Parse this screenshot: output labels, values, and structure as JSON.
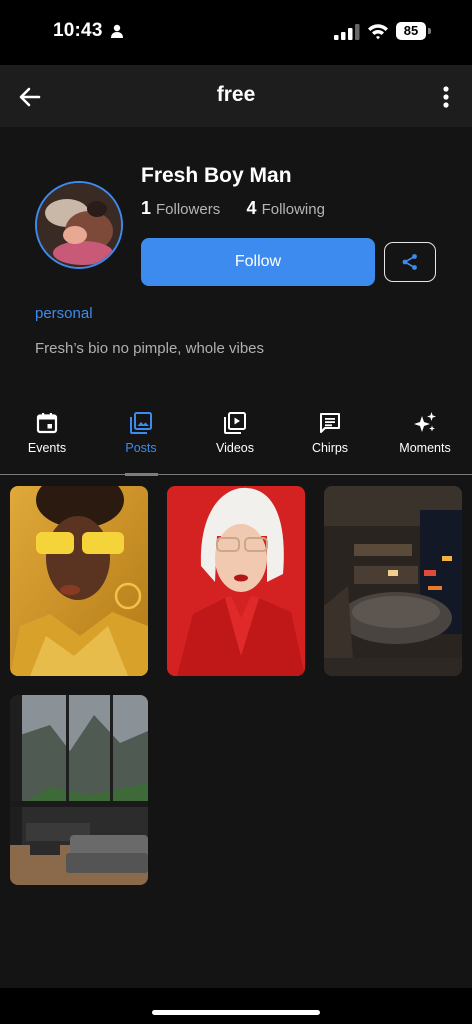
{
  "status_bar": {
    "time": "10:43",
    "battery_level": "85"
  },
  "app_bar": {
    "title": "free",
    "back_icon": "arrow-left-icon",
    "more_icon": "more-vertical-icon"
  },
  "profile": {
    "name": "Fresh Boy Man",
    "followers_count": "1",
    "followers_label": "Followers",
    "following_count": "4",
    "following_label": "Following",
    "follow_label": "Follow",
    "share_icon": "share-icon",
    "tag": "personal",
    "bio": "Fresh’s bio no pimple, whole vibes"
  },
  "tabs": [
    {
      "label": "Events",
      "icon": "calendar-icon",
      "active": false
    },
    {
      "label": "Posts",
      "icon": "photo-library-icon",
      "active": true
    },
    {
      "label": "Videos",
      "icon": "video-library-icon",
      "active": false
    },
    {
      "label": "Chirps",
      "icon": "message-icon",
      "active": false
    },
    {
      "label": "Moments",
      "icon": "sparkle-icon",
      "active": false
    }
  ],
  "posts_count": 4,
  "colors": {
    "accent": "#3d8bef",
    "background": "#141414",
    "app_bar": "#1d1d1d"
  }
}
